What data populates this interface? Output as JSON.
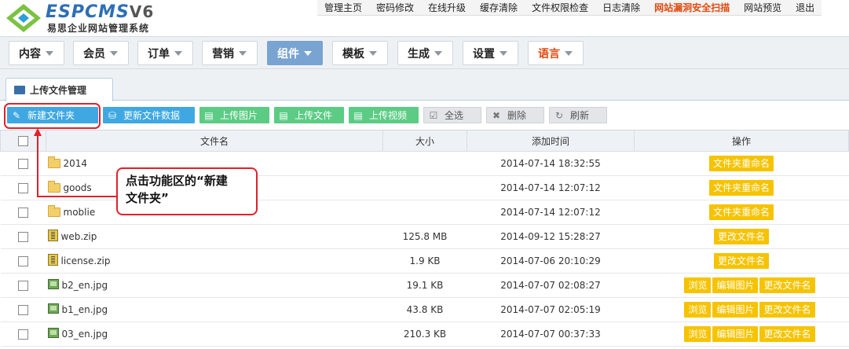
{
  "brand": {
    "name_esp": "ESP",
    "name_cms": "CMS",
    "version": "V6",
    "subtitle": "易思企业网站管理系统"
  },
  "topnav": [
    {
      "label": "管理主页"
    },
    {
      "label": "密码修改"
    },
    {
      "label": "在线升级"
    },
    {
      "label": "缓存清除"
    },
    {
      "label": "文件权限检查"
    },
    {
      "label": "日志清除"
    },
    {
      "label": "网站漏洞安全扫描"
    },
    {
      "label": "网站预览"
    },
    {
      "label": "退出"
    }
  ],
  "mainnav": [
    {
      "label": "内容"
    },
    {
      "label": "会员"
    },
    {
      "label": "订单"
    },
    {
      "label": "营销"
    },
    {
      "label": "组件"
    },
    {
      "label": "模板"
    },
    {
      "label": "生成"
    },
    {
      "label": "设置"
    },
    {
      "label": "语言"
    }
  ],
  "tab": {
    "label": "上传文件管理"
  },
  "toolbar": {
    "new_folder": "新建文件夹",
    "update_data": "更新文件数据",
    "upload_image": "上传图片",
    "upload_file": "上传文件",
    "upload_video": "上传视频",
    "select_all": "全选",
    "delete": "删除",
    "refresh": "刷新"
  },
  "table": {
    "headers": {
      "name": "文件名",
      "size": "大小",
      "time": "添加时间",
      "ops": "操作"
    },
    "rows": [
      {
        "name": "2014",
        "size": "",
        "time": "2014-07-14 18:32:55",
        "ops": [
          "文件夹重命名"
        ]
      },
      {
        "name": "goods",
        "size": "",
        "time": "2014-07-14 12:07:12",
        "ops": [
          "文件夹重命名"
        ]
      },
      {
        "name": "moblie",
        "size": "",
        "time": "2014-07-14 12:07:12",
        "ops": [
          "文件夹重命名"
        ]
      },
      {
        "name": "web.zip",
        "size": "125.8 MB",
        "time": "2014-09-12 15:28:27",
        "ops": [
          "更改文件名"
        ]
      },
      {
        "name": "license.zip",
        "size": "1.9 KB",
        "time": "2014-07-06 20:10:29",
        "ops": [
          "更改文件名"
        ]
      },
      {
        "name": "b2_en.jpg",
        "size": "19.1 KB",
        "time": "2014-07-07 02:08:27",
        "ops": [
          "浏览",
          "编辑图片",
          "更改文件名"
        ]
      },
      {
        "name": "b1_en.jpg",
        "size": "43.8 KB",
        "time": "2014-07-07 02:05:19",
        "ops": [
          "浏览",
          "编辑图片",
          "更改文件名"
        ]
      },
      {
        "name": "03_en.jpg",
        "size": "210.3 KB",
        "time": "2014-07-07 00:37:33",
        "ops": [
          "浏览",
          "编辑图片",
          "更改文件名"
        ]
      }
    ]
  },
  "annotation": {
    "line1": "点击功能区的“新建",
    "line2": "文件夹”"
  },
  "colors": {
    "accent_blue": "#3fa8e3",
    "accent_green": "#5ccc85",
    "op_yellow": "#f6c300",
    "annotation_red": "#e0212c",
    "warning_orange": "#e04a10"
  }
}
